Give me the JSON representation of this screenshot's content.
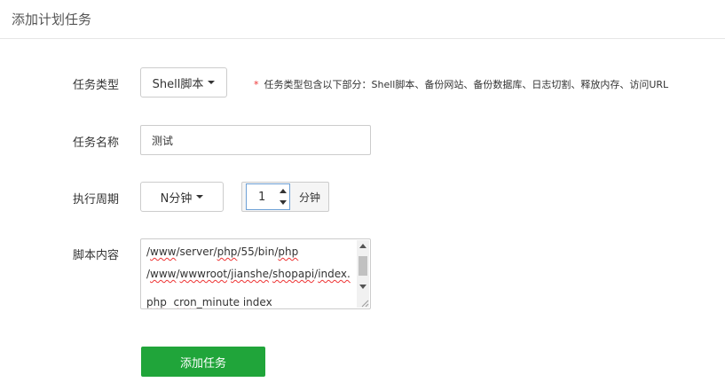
{
  "header": {
    "title": "添加计划任务"
  },
  "form": {
    "task_type": {
      "label": "任务类型",
      "selected": "Shell脚本",
      "hint_star": "*",
      "hint": "任务类型包含以下部分：Shell脚本、备份网站、备份数据库、日志切割、释放内存、访问URL"
    },
    "task_name": {
      "label": "任务名称",
      "value": "测试"
    },
    "period": {
      "label": "执行周期",
      "selected": "N分钟",
      "number": "1",
      "unit": "分钟"
    },
    "script": {
      "label": "脚本内容",
      "line1_a": "/",
      "line1_b": "www",
      "line1_c": "/server/",
      "line1_d": "php",
      "line1_e": "/55/bin/",
      "line1_f": "php",
      "line2_a": "/",
      "line2_b": "www",
      "line2_c": "/",
      "line2_d": "wwwroot",
      "line2_e": "/",
      "line2_f": "jianshe",
      "line2_g": "/",
      "line2_h": "shopapi",
      "line2_i": "/",
      "line2_j": "index.",
      "line3_a": "php",
      "line3_b": "  ",
      "line3_c": "cron",
      "line3_d": "_minute index"
    },
    "submit_label": "添加任务"
  },
  "colors": {
    "accent": "#20a53a",
    "required": "#e33333"
  }
}
